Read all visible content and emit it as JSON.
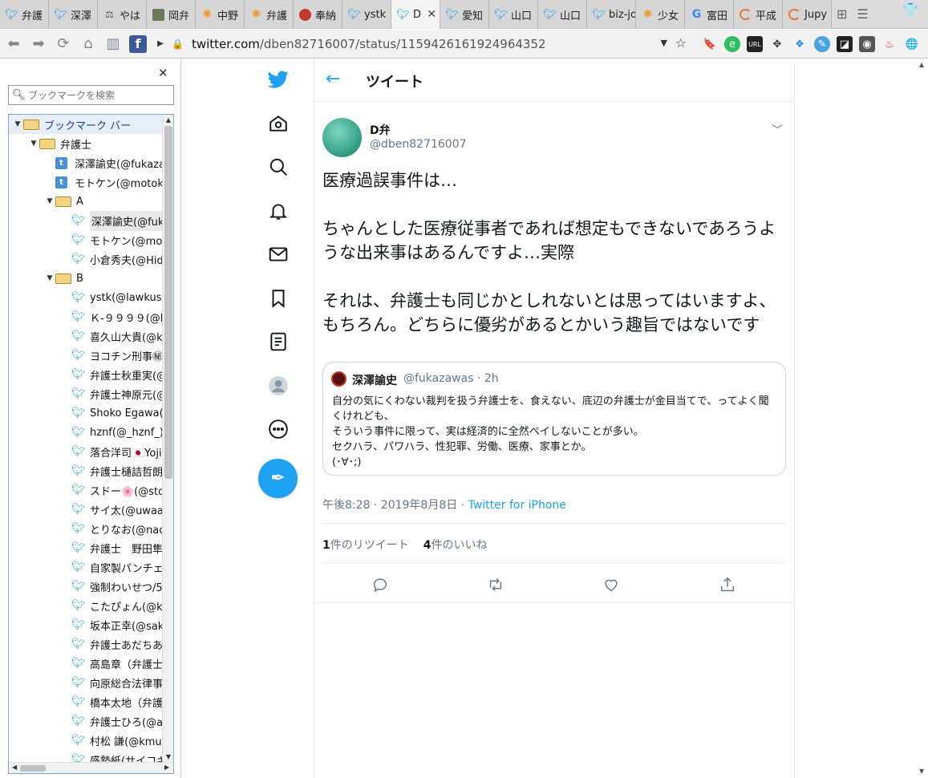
{
  "browser": {
    "tabs": [
      {
        "label": "弁護",
        "icon": "twitter-icon"
      },
      {
        "label": "深澤",
        "icon": "twitter-icon"
      },
      {
        "label": "やは",
        "icon": "scale-icon"
      },
      {
        "label": "岡弁",
        "icon": "image-icon"
      },
      {
        "label": "中野",
        "icon": "sun-icon"
      },
      {
        "label": "弁護",
        "icon": "sun-icon"
      },
      {
        "label": "奉納",
        "icon": "shrine-icon"
      },
      {
        "label": "ystk",
        "icon": "twitter-icon"
      },
      {
        "label": "D",
        "icon": "twitter-icon",
        "active": true
      },
      {
        "label": "愛知",
        "icon": "twitter-icon"
      },
      {
        "label": "山口",
        "icon": "twitter-icon"
      },
      {
        "label": "山口",
        "icon": "twitter-icon"
      },
      {
        "label": "biz-jo",
        "icon": "twitter-icon"
      },
      {
        "label": "少女",
        "icon": "sun-icon"
      },
      {
        "label": "富田",
        "icon": "google-icon"
      },
      {
        "label": "平成",
        "icon": "jupyter-icon"
      },
      {
        "label": "Jupy",
        "icon": "jupyter-icon"
      }
    ],
    "active_tab_close": "✕",
    "url_host": "twitter.com",
    "url_path": "/dben82716007/status/1159426161924964352"
  },
  "sidebar": {
    "close": "✕",
    "search_placeholder": "ブックマークを検索",
    "tree": [
      {
        "level": 0,
        "type": "folder",
        "label": "ブックマーク バー",
        "open": true
      },
      {
        "level": 1,
        "type": "folder",
        "label": "弁護士",
        "open": true
      },
      {
        "level": 2,
        "type": "tw-square",
        "label": "深澤諭史(@fukaza"
      },
      {
        "level": 2,
        "type": "tw-square",
        "label": "モトケン(@motoke"
      },
      {
        "level": 2,
        "type": "folder",
        "label": "A",
        "open": true
      },
      {
        "level": 3,
        "type": "tw",
        "label": "深澤諭史(@fuk",
        "selected": true
      },
      {
        "level": 3,
        "type": "tw",
        "label": "モトケン(@moto"
      },
      {
        "level": 3,
        "type": "tw",
        "label": "小倉秀夫(@Hid"
      },
      {
        "level": 2,
        "type": "folder",
        "label": "B",
        "open": true
      },
      {
        "level": 3,
        "type": "tw",
        "label": "ystk(@lawkus)"
      },
      {
        "level": 3,
        "type": "tw",
        "label": "Ｋ-９９９９(@k9"
      },
      {
        "level": 3,
        "type": "tw",
        "label": "喜久山大貴(@k"
      },
      {
        "level": 3,
        "type": "tw",
        "label": "ヨコチン刑事㊙"
      },
      {
        "level": 3,
        "type": "tw",
        "label": "弁護士秋重実(@"
      },
      {
        "level": 3,
        "type": "tw",
        "label": "弁護士神原元(@"
      },
      {
        "level": 3,
        "type": "tw",
        "label": "Shoko Egawa(@"
      },
      {
        "level": 3,
        "type": "tw",
        "label": "hznf(@_hznf_)"
      },
      {
        "level": 3,
        "type": "tw",
        "label": "落合洋司🇯🇵Yoji"
      },
      {
        "level": 3,
        "type": "tw",
        "label": "弁護士樋詰哲朗"
      },
      {
        "level": 3,
        "type": "tw",
        "label": "スドー🌸(@std"
      },
      {
        "level": 3,
        "type": "tw",
        "label": "サイ太(@uwaaa"
      },
      {
        "level": 3,
        "type": "tw",
        "label": "とりなお(@naot"
      },
      {
        "level": 3,
        "type": "tw",
        "label": "弁護士　野田隼"
      },
      {
        "level": 3,
        "type": "tw",
        "label": "自家製パンチェ"
      },
      {
        "level": 3,
        "type": "tw",
        "label": "強制わいせつ/5"
      },
      {
        "level": 3,
        "type": "tw",
        "label": "こたぴょん(@ko"
      },
      {
        "level": 3,
        "type": "tw",
        "label": "坂本正幸(@sak"
      },
      {
        "level": 3,
        "type": "tw",
        "label": "弁護士あだちあ"
      },
      {
        "level": 3,
        "type": "tw",
        "label": "高島章（弁護士"
      },
      {
        "level": 3,
        "type": "tw",
        "label": "向原総合法律事"
      },
      {
        "level": 3,
        "type": "tw",
        "label": "橋本太地（弁護"
      },
      {
        "level": 3,
        "type": "tw",
        "label": "弁護士ひろ(@a"
      },
      {
        "level": 3,
        "type": "tw",
        "label": "村松 謙(@kmu"
      },
      {
        "level": 3,
        "type": "tw",
        "label": "盛勢紙(サイコキ"
      }
    ]
  },
  "twitter": {
    "header_title": "ツイート",
    "author_name": "D弁",
    "author_handle": "@dben82716007",
    "tweet_paragraphs": [
      "医療過誤事件は…",
      "ちゃんとした医療従事者であれば想定もできないであろうような出来事はあるんですよ…実際",
      "それは、弁護士も同じかとしれないとは思ってはいますよ、もちろん。どちらに優劣があるとかいう趣旨ではないです"
    ],
    "quote": {
      "name": "深澤諭史",
      "handle_time": "@fukazawas · 2h",
      "lines": [
        "自分の気にくわない裁判を扱う弁護士を、食えない、底辺の弁護士が金目当てで、ってよく聞くけれども、",
        "そういう事件に限って、実は経済的に全然ペイしないことが多い。",
        "セクハラ、パワハラ、性犯罪、労働、医療、家事とか。",
        "(･∀･;)"
      ]
    },
    "timestamp": "午後8:28 · 2019年8月8日 · ",
    "source": "Twitter for iPhone",
    "retweet_count": "1",
    "retweet_label": "件のリツイート",
    "like_count": "4",
    "like_label": "件のいいね"
  }
}
